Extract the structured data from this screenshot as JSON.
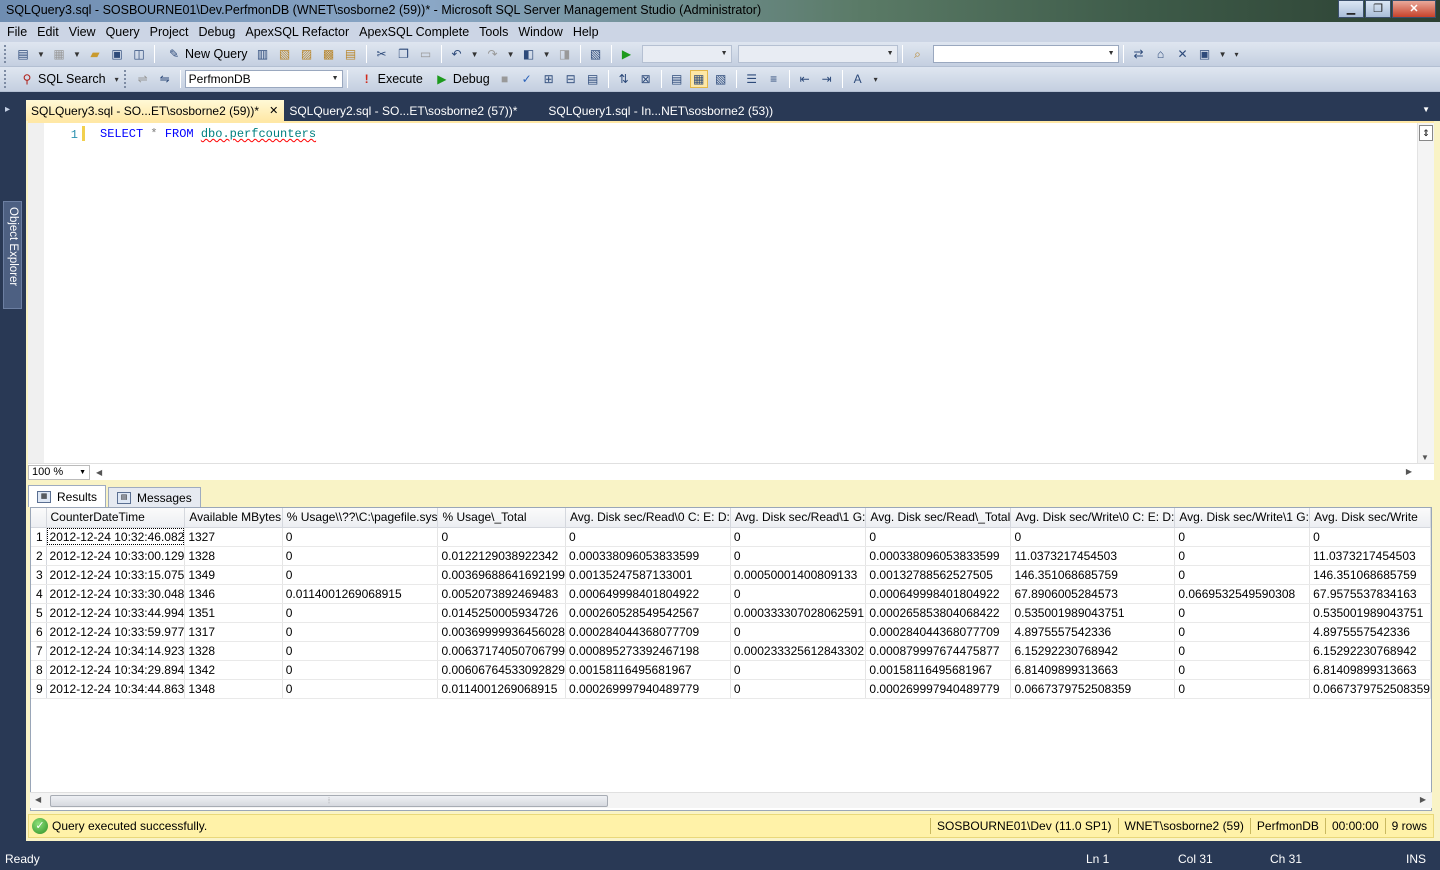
{
  "window": {
    "title": "SQLQuery3.sql - SOSBOURNE01\\Dev.PerfmonDB (WNET\\sosborne2 (59))* - Microsoft SQL Server Management Studio (Administrator)",
    "minimize": "▁",
    "maximize": "❐",
    "close": "✕"
  },
  "menu": [
    "File",
    "Edit",
    "View",
    "Query",
    "Project",
    "Debug",
    "ApexSQL Refactor",
    "ApexSQL Complete",
    "Tools",
    "Window",
    "Help"
  ],
  "toolbar1": {
    "new_query_label": "New Query"
  },
  "toolbar2": {
    "sql_search_label": "SQL Search",
    "database": "PerfmonDB",
    "execute_label": "Execute",
    "debug_label": "Debug"
  },
  "sidebar": {
    "object_explorer_label": "Object Explorer"
  },
  "doc_tabs": [
    {
      "label": "SQLQuery3.sql - SO...ET\\sosborne2 (59))*"
    },
    {
      "label": "SQLQuery2.sql - SO...ET\\sosborne2 (57))*"
    },
    {
      "label": "SQLQuery1.sql - In...NET\\sosborne2 (53))"
    }
  ],
  "editor": {
    "line_number": "1",
    "code": {
      "kw_select": "SELECT",
      "star": "*",
      "kw_from": "FROM",
      "object": "dbo.perfcounters"
    },
    "zoom": "100 %"
  },
  "result_tabs": {
    "results": "Results",
    "messages": "Messages"
  },
  "grid": {
    "columns": [
      "CounterDateTime",
      "Available MBytes",
      "% Usage\\\\??\\C:\\pagefile.sys",
      "% Usage\\_Total",
      "Avg. Disk sec/Read\\0 C: E: D:",
      "Avg. Disk sec/Read\\1 G:",
      "Avg. Disk sec/Read\\_Total",
      "Avg. Disk sec/Write\\0 C: E: D:",
      "Avg. Disk sec/Write\\1 G:",
      "Avg. Disk sec/Write"
    ],
    "rows": [
      [
        "1",
        "2012-12-24 10:32:46.082",
        "1327",
        "0",
        "0",
        "0",
        "0",
        "0",
        "0",
        "0",
        "0"
      ],
      [
        "2",
        "2012-12-24 10:33:00.129",
        "1328",
        "0",
        "0.0122129038922342",
        "0.000338096053833599",
        "0",
        "0.000338096053833599",
        "11.0373217454503",
        "0",
        "11.0373217454503"
      ],
      [
        "3",
        "2012-12-24 10:33:15.075",
        "1349",
        "0",
        "0.00369688641692199",
        "0.00135247587133001",
        "0.00050001400809133",
        "0.00132788562527505",
        "146.351068685759",
        "0",
        "146.351068685759"
      ],
      [
        "4",
        "2012-12-24 10:33:30.048",
        "1346",
        "0.0114001269068915",
        "0.0052073892469483",
        "0.000649998401804922",
        "0",
        "0.000649998401804922",
        "67.8906005284573",
        "0.0669532549590308",
        "67.9575537834163"
      ],
      [
        "5",
        "2012-12-24 10:33:44.994",
        "1351",
        "0",
        "0.0145250005934726",
        "0.000260528549542567",
        "0.000333307028062591",
        "0.000265853804068422",
        "0.535001989043751",
        "0",
        "0.535001989043751"
      ],
      [
        "6",
        "2012-12-24 10:33:59.977",
        "1317",
        "0",
        "0.00369999936456028",
        "0.000284044368077709",
        "0",
        "0.000284044368077709",
        "4.8975557542336",
        "0",
        "4.8975557542336"
      ],
      [
        "7",
        "2012-12-24 10:34:14.923",
        "1328",
        "0",
        "0.00637174050706799",
        "0.000895273392467198",
        "0.000233325612843302",
        "0.000879997674475877",
        "6.15292230768942",
        "0",
        "6.15292230768942"
      ],
      [
        "8",
        "2012-12-24 10:34:29.894",
        "1342",
        "0",
        "0.00606764533092829",
        "0.00158116495681967",
        "0",
        "0.00158116495681967",
        "6.81409899313663",
        "0",
        "6.81409899313663"
      ],
      [
        "9",
        "2012-12-24 10:34:44.863",
        "1348",
        "0",
        "0.0114001269068915",
        "0.000269997940489779",
        "0",
        "0.000269997940489779",
        "0.0667379752508359",
        "0",
        "0.0667379752508359"
      ]
    ]
  },
  "query_status": {
    "message": "Query executed successfully.",
    "server": "SOSBOURNE01\\Dev (11.0 SP1)",
    "user": "WNET\\sosborne2 (59)",
    "database": "PerfmonDB",
    "elapsed": "00:00:00",
    "rows": "9 rows"
  },
  "statusbar": {
    "ready": "Ready",
    "ln": "Ln 1",
    "col": "Col 31",
    "ch": "Ch 31",
    "mode": "INS"
  }
}
